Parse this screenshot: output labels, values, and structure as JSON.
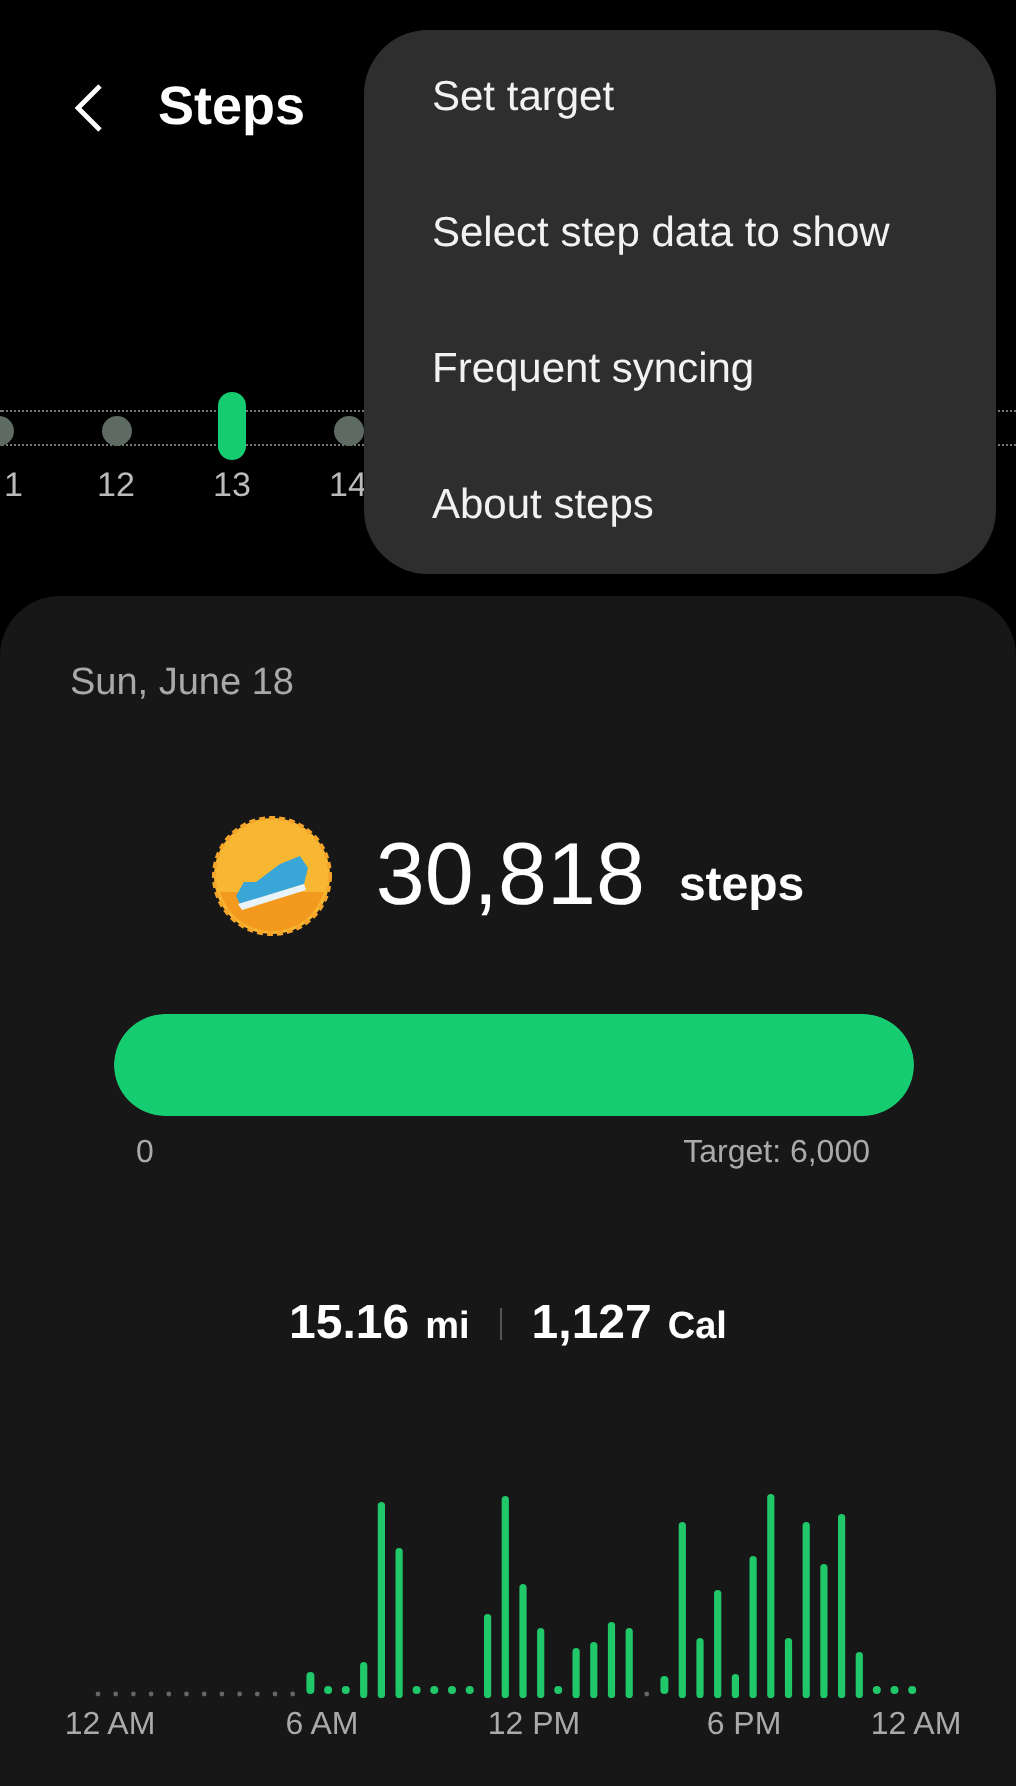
{
  "header": {
    "title": "Steps"
  },
  "days": [
    {
      "label": "1",
      "selected": false
    },
    {
      "label": "12",
      "selected": false
    },
    {
      "label": "13",
      "selected": true
    },
    {
      "label": "14",
      "selected": false
    }
  ],
  "menu": [
    "Set target",
    "Select step data to show",
    "Frequent syncing",
    "About steps"
  ],
  "card": {
    "date": "Sun, June 18",
    "count": "30,818",
    "unit": "steps",
    "progress": {
      "level": 1,
      "start": "0",
      "target": "Target: 6,000"
    },
    "stats": [
      {
        "value": "15.16",
        "unit": "mi"
      },
      {
        "value": "1,127",
        "unit": "Cal"
      }
    ],
    "time_labels": [
      "12 AM",
      "6 AM",
      "12 PM",
      "6 PM",
      "12 AM"
    ]
  }
}
